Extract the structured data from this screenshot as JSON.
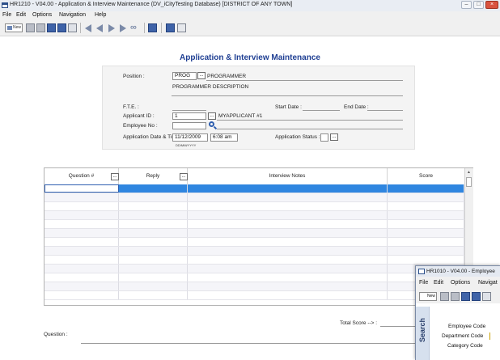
{
  "window": {
    "title": "HR1210 - V04.00 - Application & Interview Maintenance  (DV_iCityTesting Database)       [DISTRICT OF ANY TOWN]",
    "buttons": {
      "minimize": "–",
      "maximize": "□",
      "close": "×"
    }
  },
  "menu": [
    "File",
    "Edit",
    "Options",
    "Navigation",
    "Help"
  ],
  "toolbar": {
    "new_label": "New",
    "icons": [
      "new-icon",
      "edit-icon",
      "delete-icon",
      "save-icon",
      "save-as-icon",
      "print-icon",
      "first-record-icon",
      "previous-record-icon",
      "next-record-icon",
      "last-record-icon",
      "all-records-icon",
      "bookmark-icon",
      "preview-icon",
      "report-icon"
    ]
  },
  "form": {
    "title": "Application & Interview Maintenance",
    "position_label": "Position :",
    "position_code": "PROG",
    "position_name": "PROGRAMMER",
    "position_description": "PROGRAMMER DESCRIPTION",
    "fte_label": "F.T.E. :",
    "fte_value": "",
    "start_date_label": "Start Date :",
    "start_date_value": "",
    "end_date_label": "End Date :",
    "end_date_value": "",
    "applicant_id_label": "Applicant ID :",
    "applicant_id": "1",
    "applicant_name": "MYAPPLICANT #1",
    "employee_no_label": "Employee No :",
    "employee_no": "",
    "app_datetime_label": "Application Date & Time :",
    "app_date": "11/12/2009",
    "app_time": "6:08 am",
    "date_format_hint": "DD/MM/YYYY",
    "app_status_label": "Application Status :",
    "app_status": "",
    "ellipsis": "..."
  },
  "grid": {
    "columns": [
      "Question #",
      "Reply",
      "Interview Notes",
      "Score"
    ],
    "row_count": 13,
    "selected_row": 0
  },
  "footer": {
    "total_score_label": "Total Score -->  :",
    "total_score_value": "",
    "question_label": "Question :"
  },
  "second_window": {
    "title": "HR1010 - V04.00 - Employee",
    "menu": [
      "File",
      "Edit",
      "Options",
      "Navigat"
    ],
    "new_label": "New",
    "search_label": "Search",
    "fields": [
      "Employee Code",
      "Department Code",
      "Category Code"
    ]
  },
  "colors": {
    "title_blue": "#1f3f93",
    "selection": "#2f86e0",
    "close_red": "#d9533f"
  }
}
